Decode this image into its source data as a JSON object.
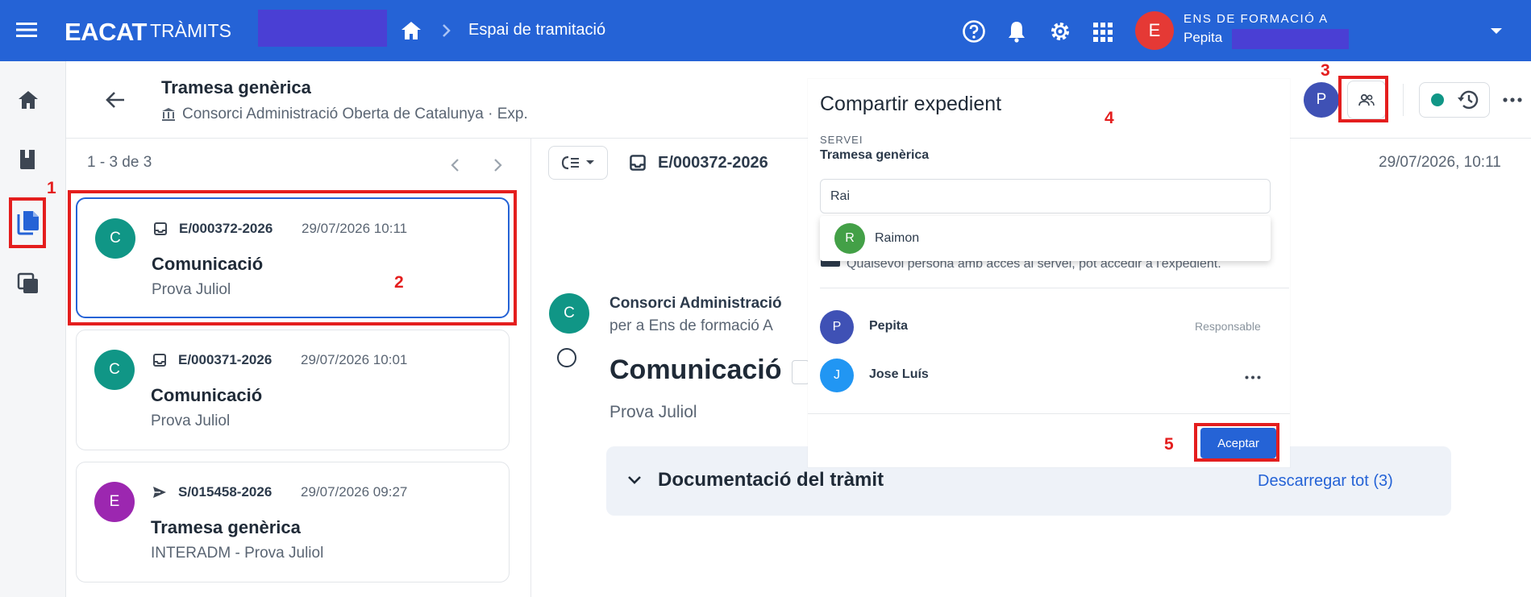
{
  "topbar": {
    "brand": "EACAT",
    "brand_sub": "TRÀMITS",
    "breadcrumb": "Espai de tramitació",
    "user_initial": "E",
    "user_org": "ENS DE FORMACIÓ A",
    "user_name": "Pepita",
    "icons": [
      "menu-icon",
      "home-icon",
      "chevron-right-icon",
      "help-icon",
      "bell-icon",
      "gear-icon",
      "apps-grid-icon",
      "caret-down-icon"
    ]
  },
  "header": {
    "title": "Tramesa genèrica",
    "subtitle": "Consorci Administració Oberta de Catalunya · Exp.",
    "owner_initial": "P"
  },
  "list": {
    "pager": "1 - 3 de 3",
    "items": [
      {
        "initial": "C",
        "avatar_color": "#109686",
        "icon": "inbox-icon",
        "code": "E/000372-2026",
        "date": "29/07/2026 10:11",
        "title": "Comunicació",
        "subtitle": "Prova Juliol"
      },
      {
        "initial": "C",
        "avatar_color": "#109686",
        "icon": "inbox-icon",
        "code": "E/000371-2026",
        "date": "29/07/2026 10:01",
        "title": "Comunicació",
        "subtitle": "Prova Juliol"
      },
      {
        "initial": "E",
        "avatar_color": "#9c27b0",
        "icon": "send-icon",
        "code": "S/015458-2026",
        "date": "29/07/2026 09:27",
        "title": "Tramesa genèrica",
        "subtitle": "INTERADM - Prova Juliol"
      }
    ]
  },
  "detail": {
    "code": "E/000372-2026",
    "date": "29/07/2026, 10:11",
    "sender_initial": "C",
    "sender": "Consorci Administració",
    "recipient": "per a Ens de formació A",
    "title": "Comunicació",
    "description": "Prova Juliol",
    "docs_title": "Documentació del tràmit",
    "docs_link": "Descarregar tot (3)"
  },
  "modal": {
    "title": "Compartir expedient",
    "service_label": "SERVEI",
    "service": "Tramesa genèrica",
    "search_value": "Rai",
    "suggestion": {
      "initial": "R",
      "name": "Raimon"
    },
    "access_note": "Qualsevol persona amb accés al servei, pot accedir a l'expedient.",
    "members": [
      {
        "initial": "P",
        "name": "Pepita",
        "role": "Responsable",
        "color": "#3f51b5"
      },
      {
        "initial": "J",
        "name": "Jose Luís",
        "role": "",
        "color": "#2196f3"
      }
    ],
    "accept_label": "Aceptar"
  },
  "annotations": [
    "1",
    "2",
    "3",
    "4",
    "5"
  ],
  "colors": {
    "primary": "#2563d6",
    "annotation": "#e41e1e",
    "teal": "#109686"
  }
}
